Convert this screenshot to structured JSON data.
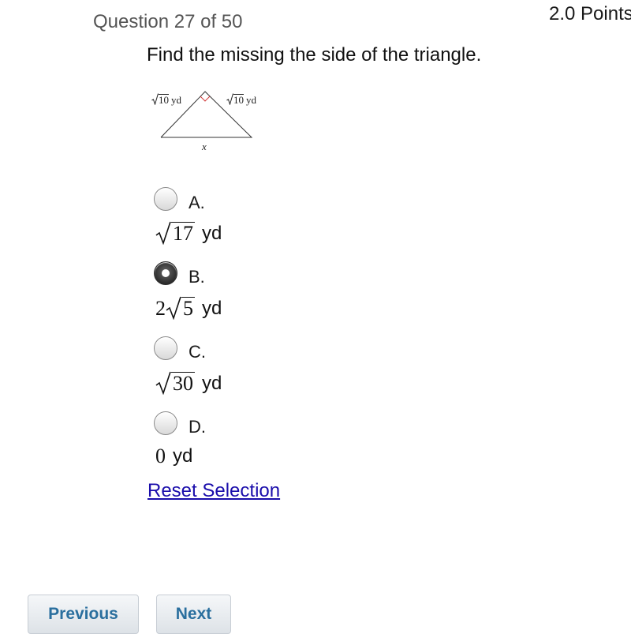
{
  "header": {
    "question_counter": "Question 27 of 50",
    "points": "2.0 Points"
  },
  "question": {
    "prompt": "Find the missing the side of the triangle.",
    "figure": {
      "left_side_radicand": "10",
      "left_side_unit": "yd",
      "right_side_radicand": "10",
      "right_side_unit": "yd",
      "base_label": "x"
    }
  },
  "options": [
    {
      "letter": "A.",
      "coefficient": "",
      "radicand": "17",
      "unit": "yd",
      "selected": false
    },
    {
      "letter": "B.",
      "coefficient": "2",
      "radicand": "5",
      "unit": "yd",
      "selected": true
    },
    {
      "letter": "C.",
      "coefficient": "",
      "radicand": "30",
      "unit": "yd",
      "selected": false
    },
    {
      "letter": "D.",
      "value": "0",
      "unit": "yd",
      "selected": false
    }
  ],
  "reset_label": "Reset Selection",
  "nav": {
    "previous_label": "Previous",
    "next_label": "Next"
  }
}
